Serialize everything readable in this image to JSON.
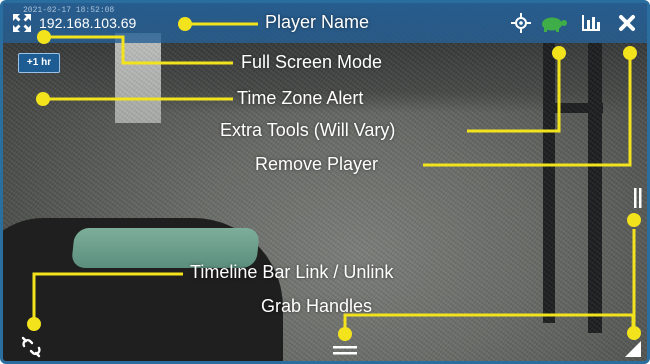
{
  "player": {
    "timestamp": "2021-02-17 18:52:08",
    "ip": "192.168.103.69",
    "time_zone_badge": "+1 hr"
  },
  "toolbar": {
    "icons": [
      "fullscreen-icon",
      "move-icon",
      "turtle-icon",
      "bar-chart-icon",
      "close-icon"
    ]
  },
  "callouts": {
    "player_name": "Player Name",
    "full_screen_mode": "Full Screen Mode",
    "time_zone_alert": "Time Zone Alert",
    "extra_tools": "Extra Tools (Will Vary)",
    "remove_player": "Remove Player",
    "timeline_link": "Timeline Bar Link / Unlink",
    "grab_handles": "Grab Handles"
  },
  "colors": {
    "callout": "#f3e31c",
    "toolbar": "#26609a",
    "turtle": "#3fae49"
  }
}
